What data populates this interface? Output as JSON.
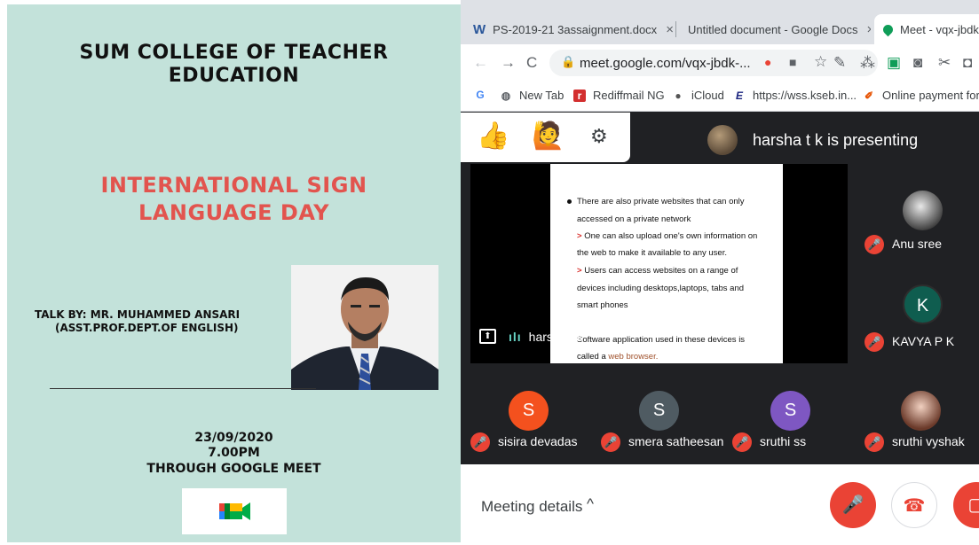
{
  "poster": {
    "college_line1": "SUM COLLEGE OF TEACHER",
    "college_line2": "EDUCATION",
    "event_line1": "INTERNATIONAL SIGN",
    "event_line2": "LANGUAGE DAY",
    "talk_by": "TALK BY: MR. MUHAMMED ANSARI",
    "designation": "(ASST.PROF.DEPT.OF ENGLISH)",
    "date": "23/09/2020",
    "time": "7.00PM",
    "platform": "THROUGH GOOGLE MEET"
  },
  "browser": {
    "tabs": [
      {
        "label": "PS-2019-21 3assaignment.docx",
        "close": "×",
        "icon": "word-icon",
        "active": false
      },
      {
        "label": "Untitled document - Google Docs",
        "close": "×",
        "icon": "docs-icon",
        "active": false
      },
      {
        "label": "Meet - vqx-jbdk-g",
        "close": "",
        "icon": "meet-tab-icon",
        "active": true
      }
    ],
    "url": "meet.google.com/vqx-jbdk-...",
    "bookmarks": [
      {
        "label": "New Tab",
        "icon": "globe-icon"
      },
      {
        "label": "Rediffmail NG",
        "icon": "rediff-icon"
      },
      {
        "label": "iCloud",
        "icon": "apple-icon"
      },
      {
        "label": "https://wss.kseb.in...",
        "icon": "kseb-icon"
      },
      {
        "label": "Online payment for...",
        "icon": "payment-icon"
      }
    ],
    "bookmark_g": "G"
  },
  "meet": {
    "presenting_text": "harsha t k is presenting",
    "slide": {
      "line1": "There are also private websites that can only",
      "line2": "accessed on a private network",
      "arrow": ">",
      "line3": "One can also upload one's own information on",
      "line4": "the web to make it available to any user.",
      "line5": "Users can access websites on a range of",
      "line6": "devices including desktops,laptops, tabs and",
      "line7": "smart phones",
      "line8": "Software application used in these devices is",
      "line9_prefix": "called a ",
      "line9_link": "web browser."
    },
    "screen_tile_name": "harsha t k",
    "participants": [
      {
        "name": "Anu sree",
        "initial": "",
        "color": "#5a5a5a"
      },
      {
        "name": "KAVYA P K",
        "initial": "K",
        "color": "#0f5d4f"
      },
      {
        "name": "sisira devadas",
        "initial": "S",
        "color": "#f4511e"
      },
      {
        "name": "smera satheesan",
        "initial": "S",
        "color": "#4f5b62"
      },
      {
        "name": "sruthi ss",
        "initial": "S",
        "color": "#7e57c2"
      },
      {
        "name": "sruthi vyshak",
        "initial": "",
        "color": "#c98a72"
      }
    ],
    "meeting_details": "Meeting details",
    "chevron": "^"
  },
  "colors": {
    "poster_bg": "#c3e2da",
    "event_red": "#e2544e",
    "meet_bg": "#202124",
    "mic_off_red": "#ea4335"
  }
}
